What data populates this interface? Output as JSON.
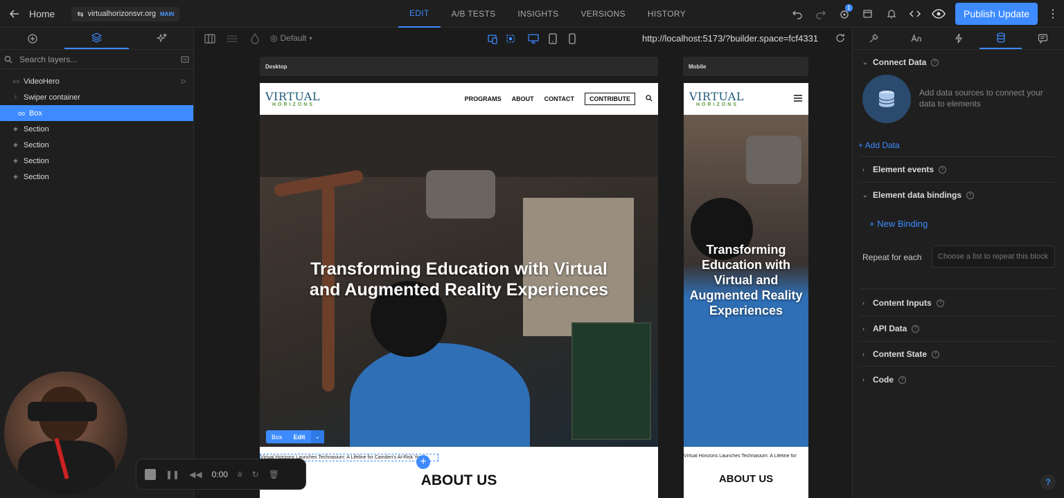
{
  "topbar": {
    "home_label": "Home",
    "site_name": "virtualhorizonsvr.org",
    "branch": "MAIN",
    "tabs": [
      {
        "label": "EDIT"
      },
      {
        "label": "A/B TESTS"
      },
      {
        "label": "INSIGHTS"
      },
      {
        "label": "VERSIONS"
      },
      {
        "label": "HISTORY"
      }
    ],
    "notification_count": "1",
    "publish_label": "Publish Update"
  },
  "layers": {
    "search_placeholder": "Search layers...",
    "items": [
      {
        "label": "VideoHero"
      },
      {
        "label": "Swiper container"
      },
      {
        "label": "Box"
      },
      {
        "label": "Section"
      },
      {
        "label": "Section"
      },
      {
        "label": "Section"
      },
      {
        "label": "Section"
      }
    ]
  },
  "canvas": {
    "breakpoint": "Default",
    "url": "http://localhost:5173/?builder.space=fcf4331",
    "desktop_label": "Desktop",
    "mobile_label": "Mobile"
  },
  "site": {
    "logo_top": "VIRTUAL",
    "logo_bottom": "HORIZONS",
    "nav": [
      "PROGRAMS",
      "ABOUT",
      "CONTACT",
      "CONTRIBUTE"
    ],
    "hero_title_line1": "Transforming Education with Virtual",
    "hero_title_line2": "and Augmented Reality Experiences",
    "mobile_title": "Transforming Education with Virtual and Augmented Reality Experiences",
    "caption": "Virtual Horizons Launches Technasium: A Lifeline for Camden's At-Risk Youth",
    "mobile_caption": "Virtual Horizons Launches Technasium: A Lifeline for",
    "about_heading": "ABOUT US",
    "editbar": {
      "box": "Box",
      "edit": "Edit"
    }
  },
  "rightpanel": {
    "connect_data": "Connect Data",
    "connect_desc": "Add data sources to connect your data to elements",
    "add_data": "+ Add Data",
    "element_events": "Element events",
    "element_bindings": "Element data bindings",
    "new_binding": "+ New Binding",
    "repeat_label": "Repeat for each",
    "repeat_placeholder": "Choose a list to repeat this block",
    "content_inputs": "Content Inputs",
    "api_data": "API Data",
    "content_state": "Content State",
    "code": "Code",
    "help": "?"
  },
  "recorder": {
    "time": "0:00"
  },
  "colors": {
    "accent": "#3d8bff",
    "panel": "#1f1f1f"
  }
}
